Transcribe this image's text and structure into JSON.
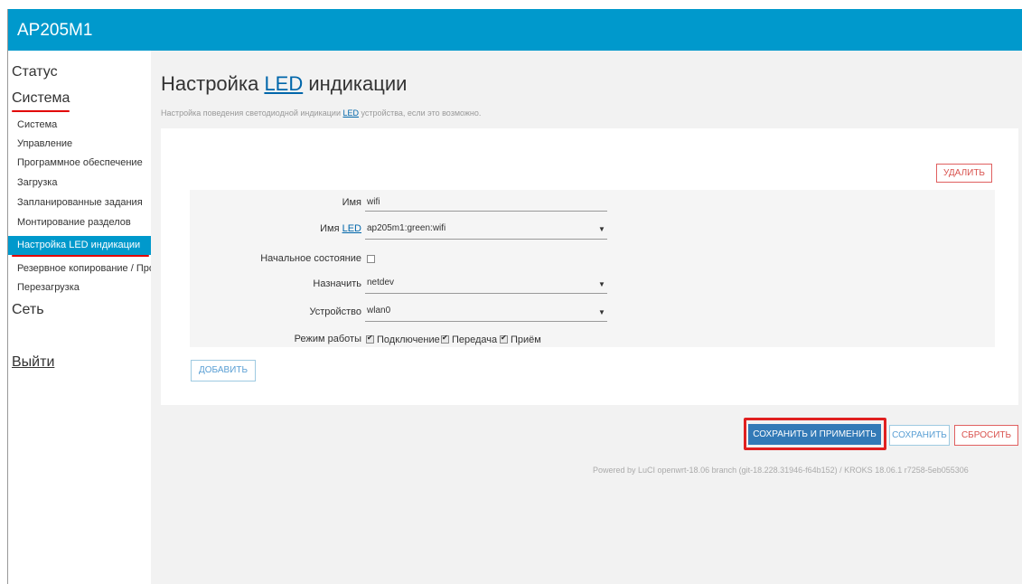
{
  "header": {
    "brand": "AP205M1"
  },
  "sidebar": {
    "status": "Статус",
    "system": "Система",
    "network": "Сеть",
    "logout": "Выйти",
    "items": [
      {
        "label": "Система"
      },
      {
        "label": "Управление"
      },
      {
        "label": "Программное обеспечение"
      },
      {
        "label": "Загрузка"
      },
      {
        "label": "Запланированные задания"
      },
      {
        "label": "Монтирование разделов"
      },
      {
        "label": "Настройка LED индикации"
      },
      {
        "label": "Резервное копирование / Прошивка"
      },
      {
        "label": "Перезагрузка"
      }
    ]
  },
  "page": {
    "title_prefix": "Настройка",
    "title_led": "LED",
    "title_suffix": "индикации",
    "desc_prefix": "Настройка поведения светодиодной индикации",
    "desc_led": "LED",
    "desc_suffix": "устройства, если это возможно."
  },
  "form": {
    "delete": "УДАЛИТЬ",
    "name_label": "Имя",
    "name_value": "wifi",
    "led_label_prefix": "Имя",
    "led_label_led": "LED",
    "led_value": "ap205m1:green:wifi",
    "initial_state_label": "Начальное состояние",
    "trigger_label": "Назначить",
    "trigger_value": "netdev",
    "device_label": "Устройство",
    "device_value": "wlan0",
    "mode_label": "Режим работы",
    "mode_link": "Подключение",
    "mode_tx": "Передача",
    "mode_rx": "Приём",
    "add": "ДОБАВИТЬ"
  },
  "actions": {
    "save_apply": "СОХРАНИТЬ И ПРИМЕНИТЬ",
    "save": "СОХРАНИТЬ",
    "reset": "СБРОСИТЬ"
  },
  "footer": {
    "text": "Powered by LuCI openwrt-18.06 branch (git-18.228.31946-f64b152) / KROKS 18.06.1 r7258-5eb055306"
  },
  "colors": {
    "header": "#0099cc",
    "primary": "#337ab7",
    "danger": "#d9534f",
    "highlight": "#e02020"
  }
}
